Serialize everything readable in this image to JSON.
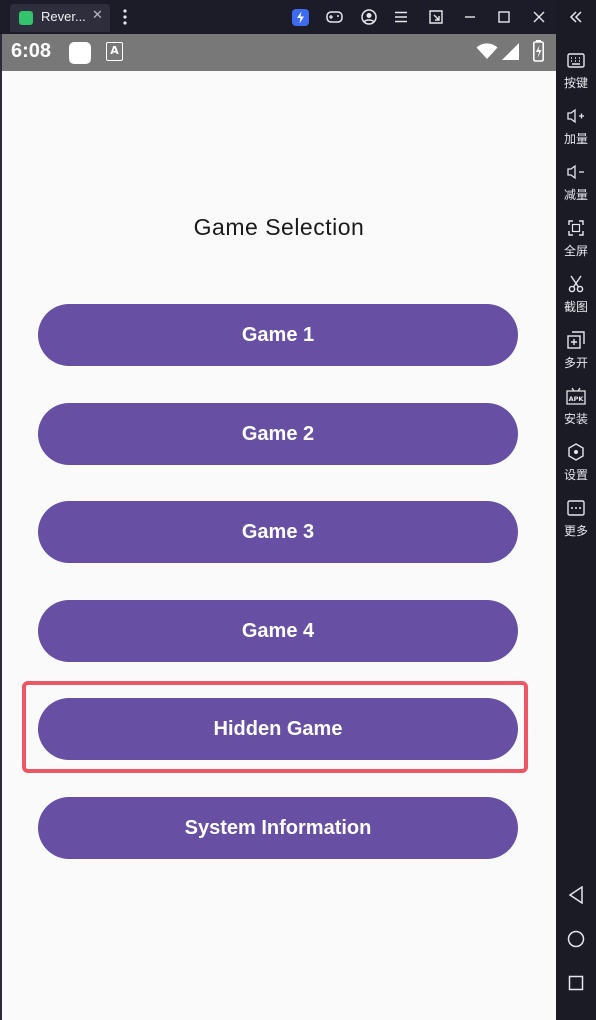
{
  "window": {
    "tab_title": "Rever...",
    "tab_close": "✕"
  },
  "status_bar": {
    "time": "6:08",
    "notification_letter": "A"
  },
  "app": {
    "title": "Game Selection",
    "buttons": [
      {
        "label": "Game 1"
      },
      {
        "label": "Game 2"
      },
      {
        "label": "Game 3"
      },
      {
        "label": "Game 4"
      },
      {
        "label": "Hidden Game",
        "highlighted": true
      },
      {
        "label": "System Information"
      }
    ],
    "accent_color": "#6750a4",
    "highlight_color": "#ef5663"
  },
  "sidebar": {
    "items": [
      {
        "label": "按键",
        "icon": "keyboard-icon"
      },
      {
        "label": "加量",
        "icon": "volume-up-icon"
      },
      {
        "label": "减量",
        "icon": "volume-down-icon"
      },
      {
        "label": "全屏",
        "icon": "fullscreen-icon"
      },
      {
        "label": "截图",
        "icon": "scissors-icon"
      },
      {
        "label": "多开",
        "icon": "multi-instance-icon"
      },
      {
        "label": "安装",
        "icon": "apk-icon"
      },
      {
        "label": "设置",
        "icon": "settings-icon"
      },
      {
        "label": "更多",
        "icon": "more-icon"
      }
    ],
    "nav": [
      "back-icon",
      "home-icon",
      "recents-icon"
    ]
  }
}
